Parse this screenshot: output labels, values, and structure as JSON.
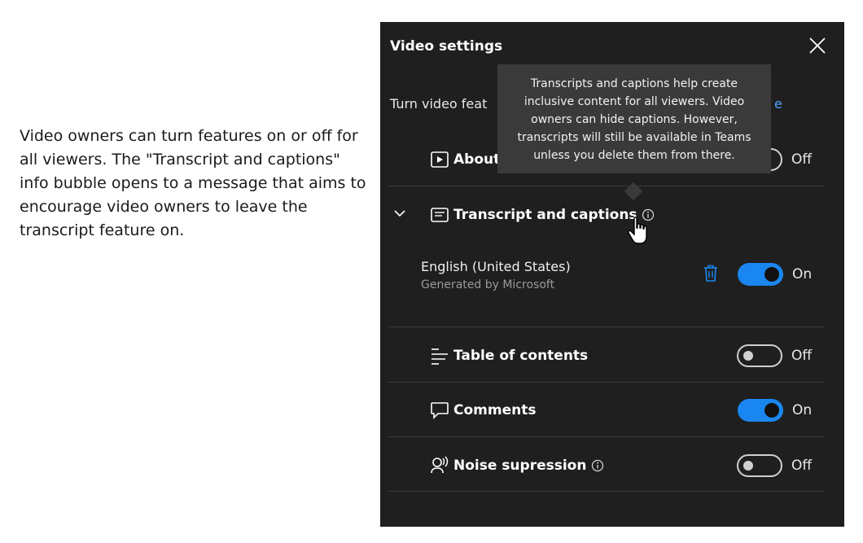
{
  "caption": "Video owners can turn features on or off for all viewers. The \"Transcript and captions\" info bubble opens to a message that aims to encourage video owners to leave the transcript feature on.",
  "panel": {
    "title": "Video settings",
    "subtitle_visible": "Turn video feat",
    "subtitle_link_visible": "e",
    "tooltip": "Transcripts and captions help create inclusive content for all viewers. Video owners can hide captions. However, transcripts will still be available in Teams unless you delete them from there.",
    "about": {
      "label": "About",
      "state": "Off"
    },
    "transcript": {
      "label": "Transcript and captions",
      "language": "English (United States)",
      "generated_by": "Generated by Microsoft",
      "state": "On"
    },
    "table_of_contents": {
      "label": "Table of contents",
      "state": "Off"
    },
    "comments": {
      "label": "Comments",
      "state": "On"
    },
    "noise_suppression": {
      "label": "Noise supression",
      "state": "Off"
    }
  },
  "colors": {
    "panel_bg": "#1f1f1f",
    "accent": "#1a86f0",
    "link": "#4da3ff"
  }
}
